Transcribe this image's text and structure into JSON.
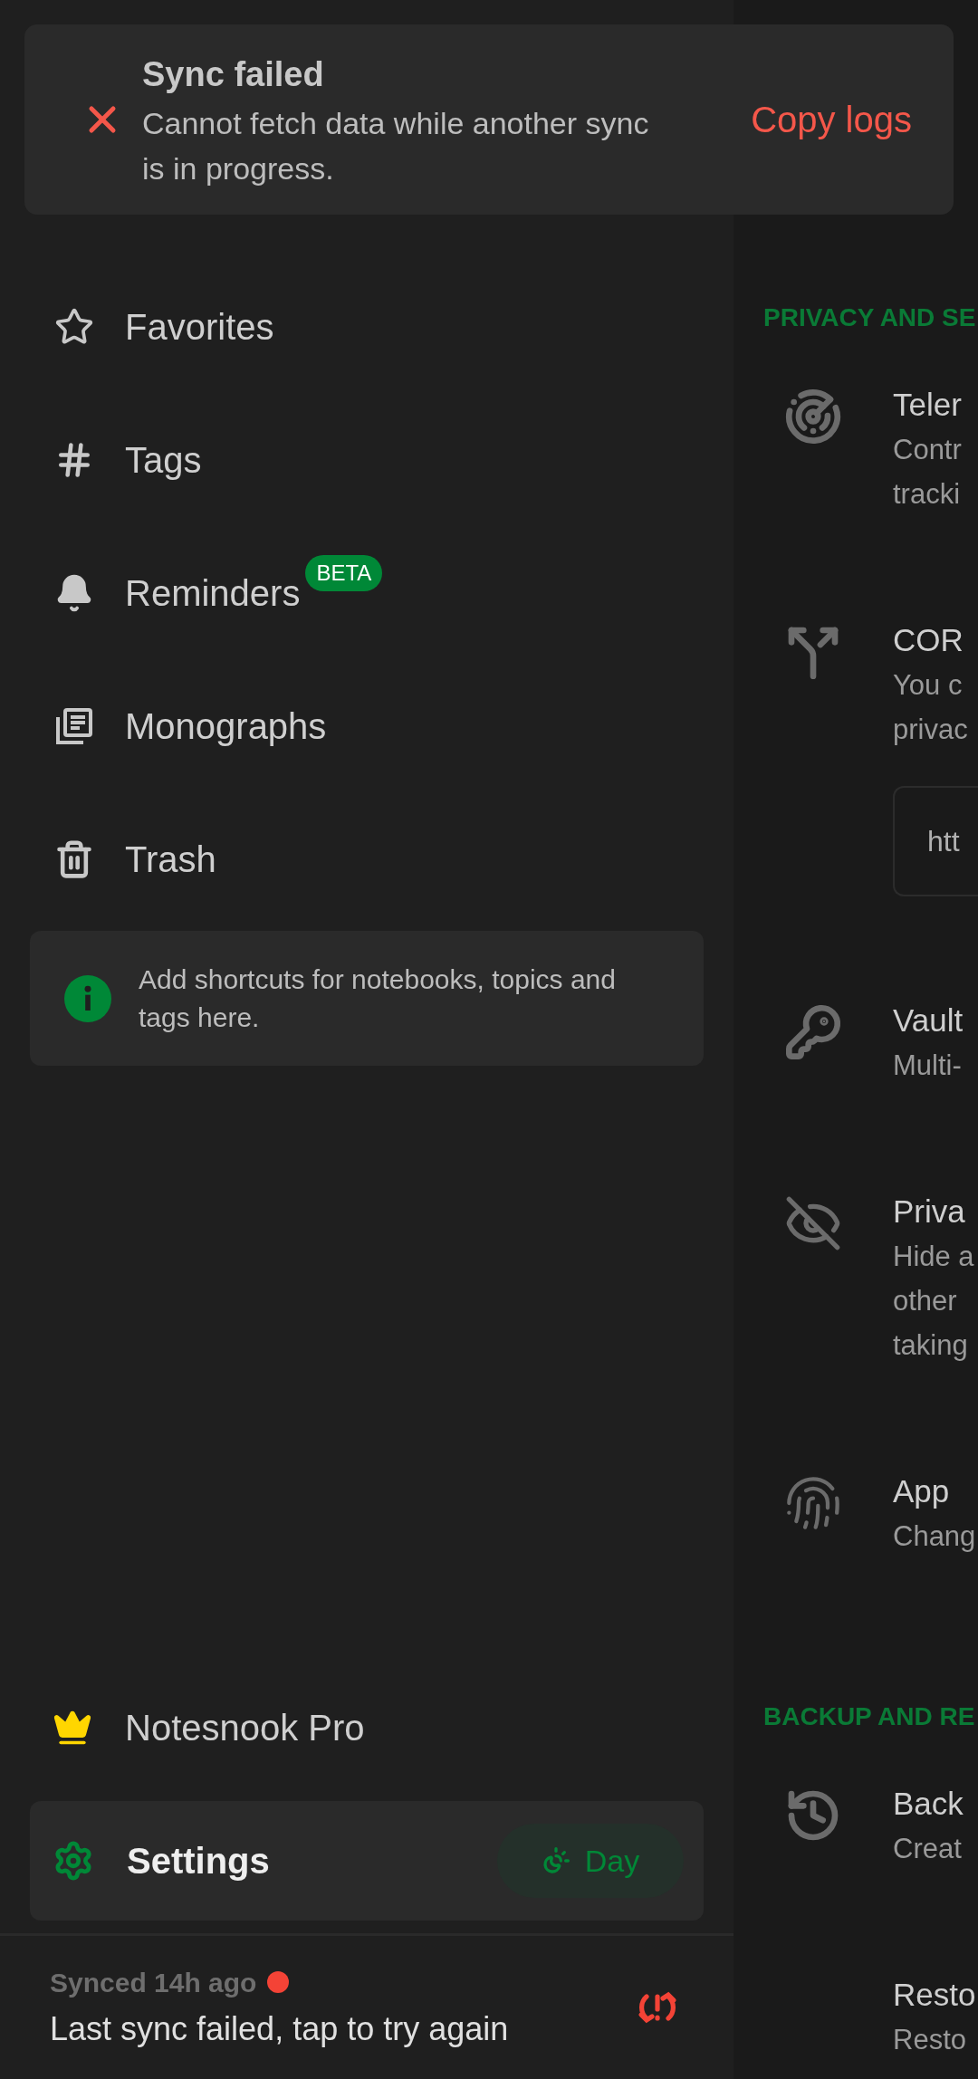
{
  "toast": {
    "title": "Sync failed",
    "message": "Cannot fetch data while another sync is in progress.",
    "action": "Copy logs"
  },
  "sidebar": {
    "items": [
      {
        "kind": "favorites",
        "label": "Favorites"
      },
      {
        "kind": "tags",
        "label": "Tags"
      },
      {
        "kind": "reminders",
        "label": "Reminders",
        "badge": "BETA"
      },
      {
        "kind": "monographs",
        "label": "Monographs"
      },
      {
        "kind": "trash",
        "label": "Trash"
      }
    ],
    "shortcuts_hint": "Add shortcuts for notebooks, topics and tags here.",
    "pro": {
      "label": "Notesnook Pro"
    },
    "settings": {
      "label": "Settings",
      "selected": true,
      "theme_button": "Day"
    },
    "sync": {
      "status": "Synced 14h ago",
      "message": "Last sync failed, tap to try again",
      "failed": true
    }
  },
  "settings_panel": {
    "sections": [
      {
        "title": "PRIVACY AND SE",
        "items": [
          {
            "kind": "telemetry",
            "title": "Teler",
            "lines": [
              "Contr",
              "tracki"
            ]
          },
          {
            "kind": "cors",
            "title": "COR",
            "lines": [
              "You c",
              "privac"
            ],
            "field_value": "htt"
          },
          {
            "kind": "vault",
            "title": "Vault",
            "lines": [
              "Multi-"
            ]
          },
          {
            "kind": "privacy",
            "title": "Priva",
            "lines": [
              "Hide a",
              "other",
              "taking"
            ]
          },
          {
            "kind": "applock",
            "title": "App",
            "lines": [
              "Chang"
            ]
          }
        ]
      },
      {
        "title": "BACKUP AND RE",
        "items": [
          {
            "kind": "backup",
            "title": "Back",
            "lines": [
              "Creat"
            ]
          },
          {
            "kind": "restore",
            "title": "Resto",
            "lines": [
              "Resto"
            ]
          }
        ]
      }
    ]
  }
}
